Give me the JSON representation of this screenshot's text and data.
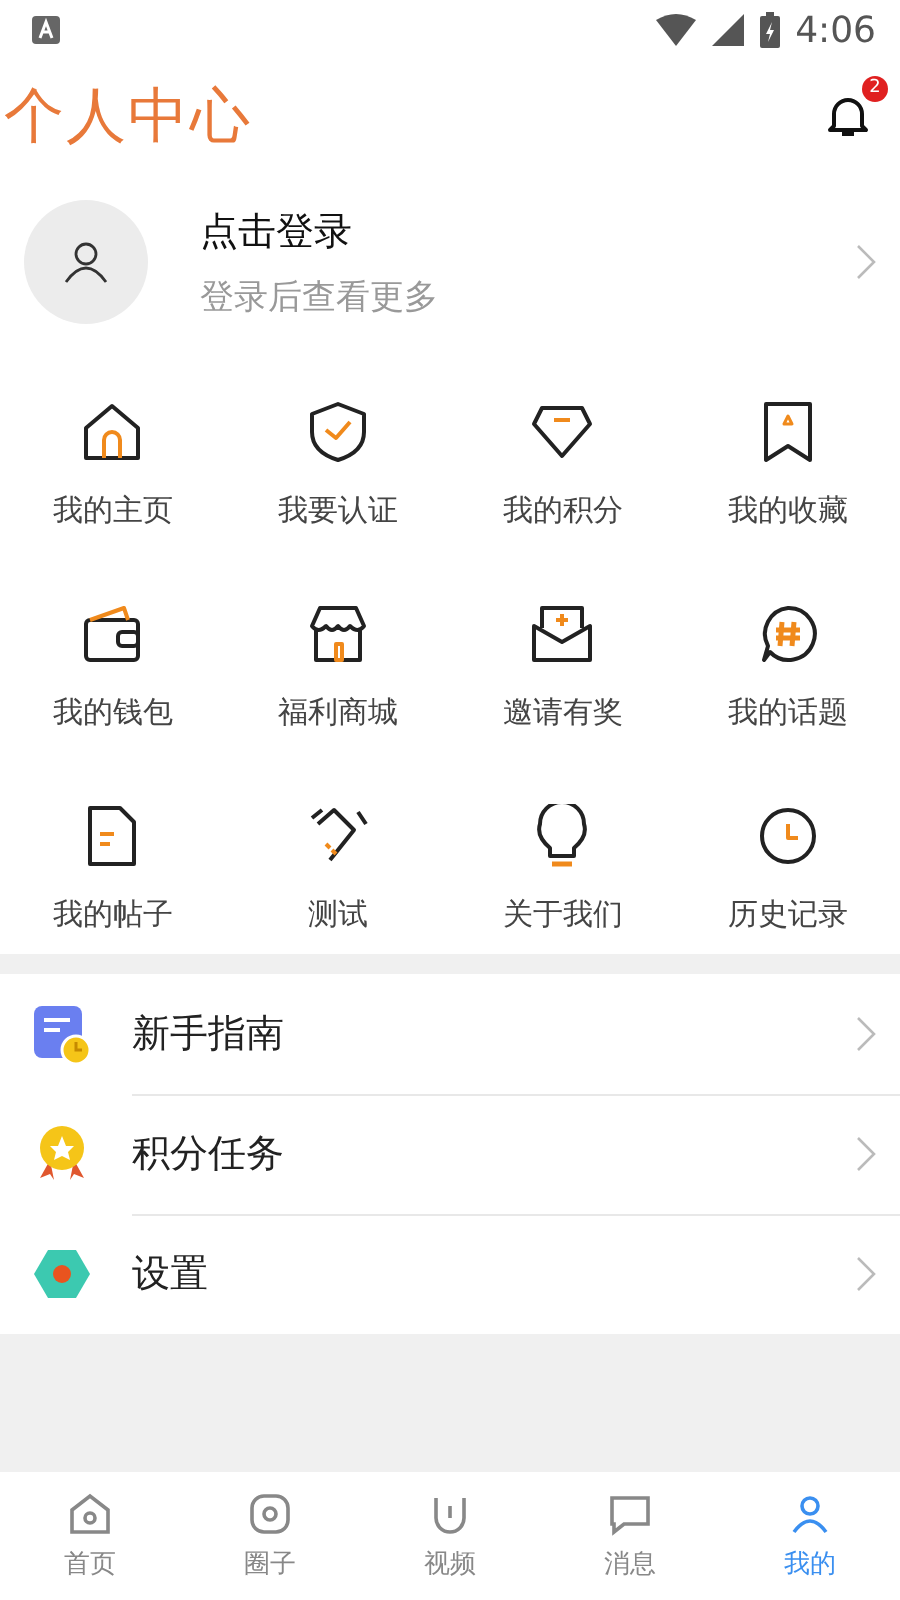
{
  "status_bar": {
    "time": "4:06"
  },
  "header": {
    "title": "个人中心",
    "notification_badge": "2"
  },
  "profile": {
    "title": "点击登录",
    "subtitle": "登录后查看更多"
  },
  "grid": [
    {
      "label": "我的主页"
    },
    {
      "label": "我要认证"
    },
    {
      "label": "我的积分"
    },
    {
      "label": "我的收藏"
    },
    {
      "label": "我的钱包"
    },
    {
      "label": "福利商城"
    },
    {
      "label": "邀请有奖"
    },
    {
      "label": "我的话题"
    },
    {
      "label": "我的帖子"
    },
    {
      "label": "测试"
    },
    {
      "label": "关于我们"
    },
    {
      "label": "历史记录"
    }
  ],
  "menu": [
    {
      "label": "新手指南"
    },
    {
      "label": "积分任务"
    },
    {
      "label": "设置"
    }
  ],
  "tab_bar": [
    {
      "label": "首页",
      "selected": false
    },
    {
      "label": "圈子",
      "selected": false
    },
    {
      "label": "视频",
      "selected": false
    },
    {
      "label": "消息",
      "selected": false
    },
    {
      "label": "我的",
      "selected": true
    }
  ]
}
